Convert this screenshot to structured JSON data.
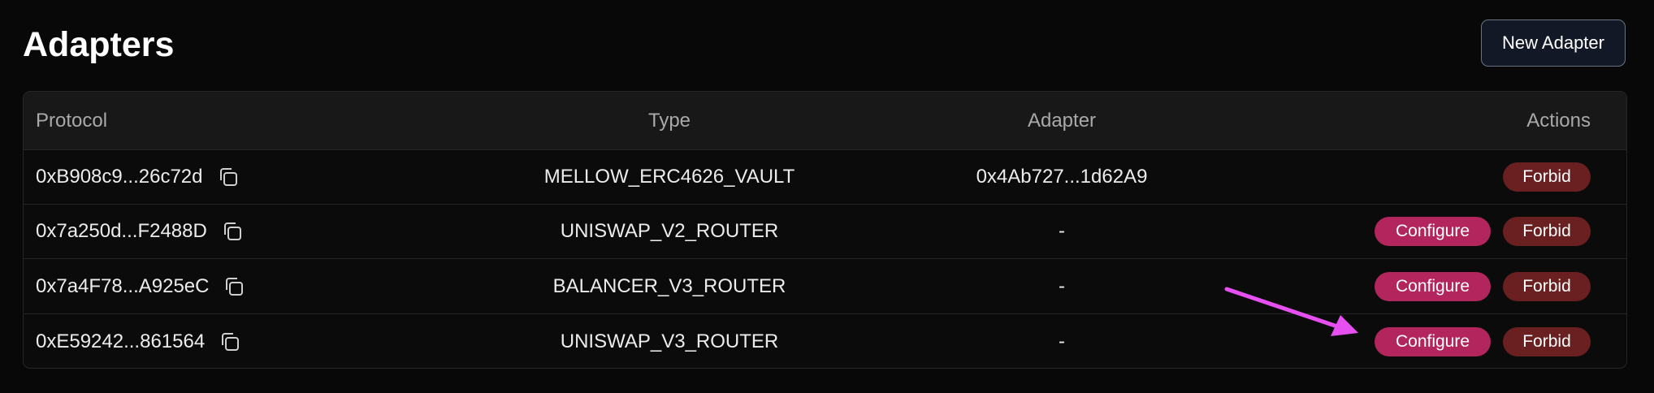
{
  "page": {
    "title": "Adapters"
  },
  "toolbar": {
    "new_adapter_label": "New Adapter"
  },
  "table": {
    "headers": {
      "protocol": "Protocol",
      "type": "Type",
      "adapter": "Adapter",
      "actions": "Actions"
    },
    "rows": [
      {
        "protocol": "0xB908c9...26c72d",
        "type": "MELLOW_ERC4626_VAULT",
        "adapter": "0x4Ab727...1d62A9",
        "configure": "",
        "forbid": "Forbid"
      },
      {
        "protocol": "0x7a250d...F2488D",
        "type": "UNISWAP_V2_ROUTER",
        "adapter": "-",
        "configure": "Configure",
        "forbid": "Forbid"
      },
      {
        "protocol": "0x7a4F78...A925eC",
        "type": "BALANCER_V3_ROUTER",
        "adapter": "-",
        "configure": "Configure",
        "forbid": "Forbid"
      },
      {
        "protocol": "0xE59242...861564",
        "type": "UNISWAP_V3_ROUTER",
        "adapter": "-",
        "configure": "Configure",
        "forbid": "Forbid"
      }
    ]
  },
  "icons": {
    "copy": "copy-icon",
    "annotation": "arrow-annotation"
  },
  "colors": {
    "background": "#080808",
    "configure": "#b3265d",
    "forbid": "#6a2021",
    "annotation_arrow": "#e64ff0"
  }
}
